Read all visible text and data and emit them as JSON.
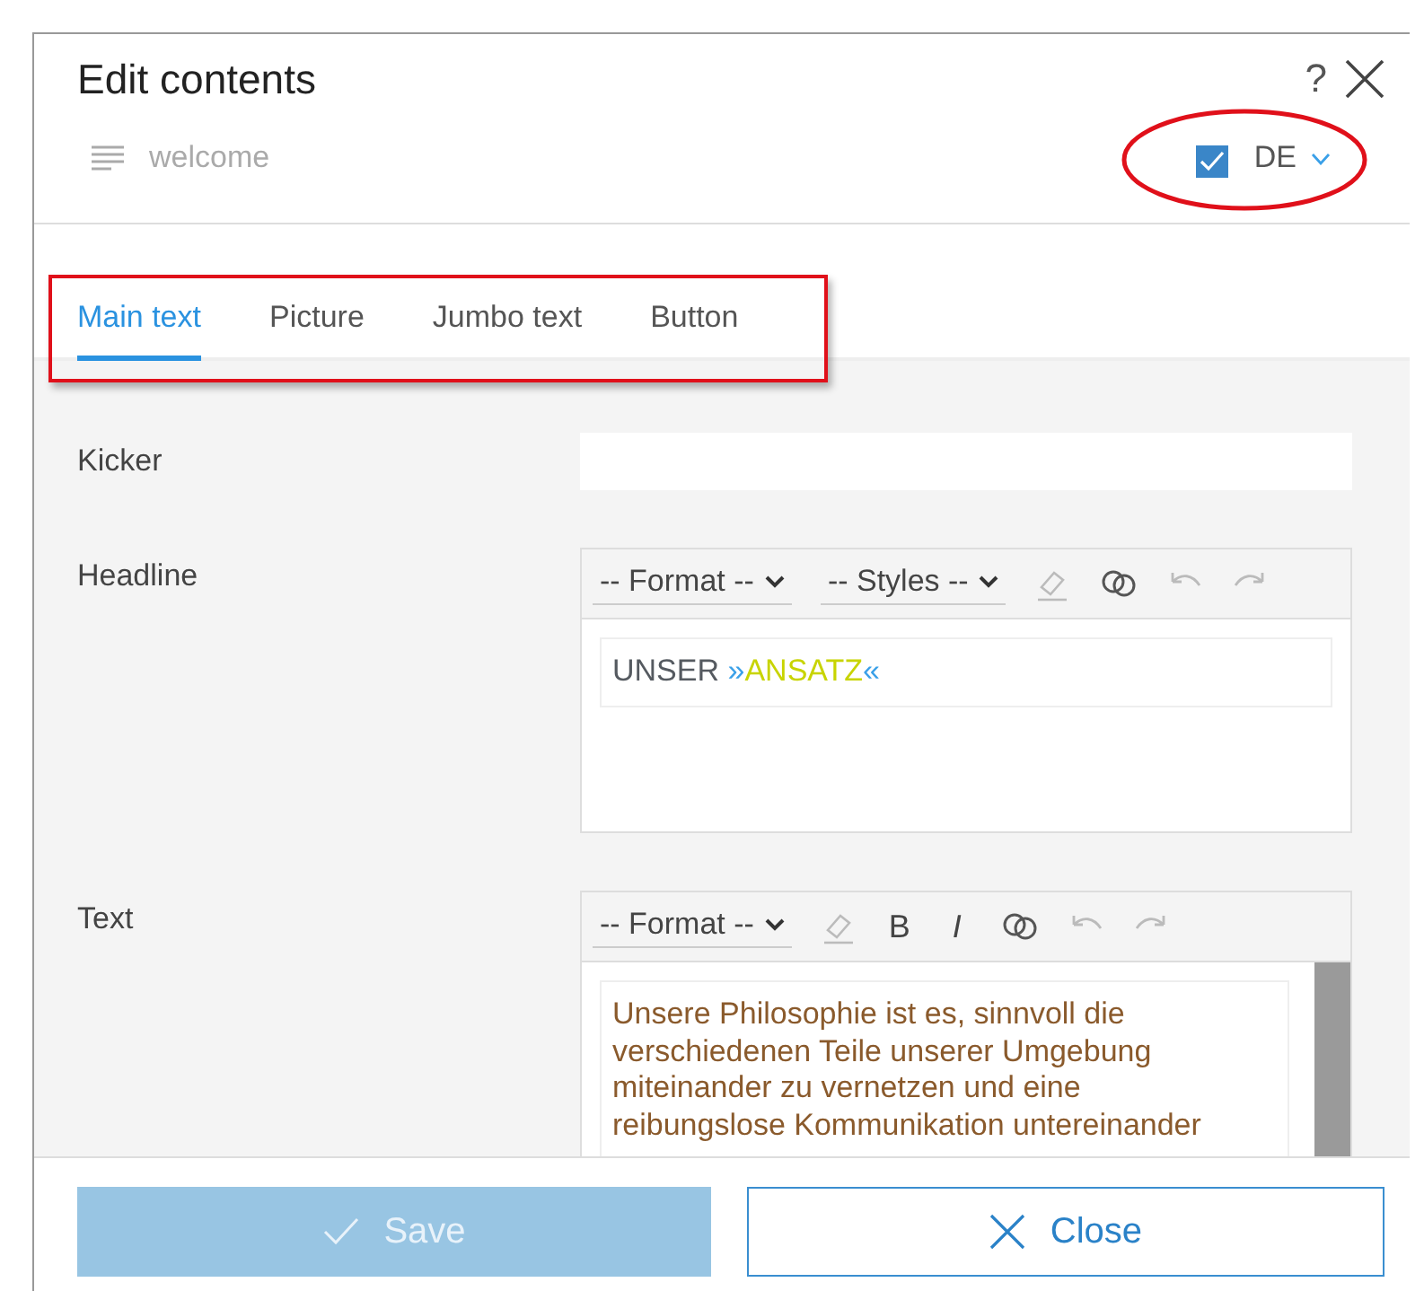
{
  "dialog": {
    "title": "Edit contents",
    "help": "?",
    "subtitle": "welcome",
    "language_enabled": {
      "checked": true
    },
    "language": "DE"
  },
  "tabs": [
    {
      "label": "Main text",
      "selected": true
    },
    {
      "label": "Picture",
      "selected": false
    },
    {
      "label": "Jumbo text",
      "selected": false
    },
    {
      "label": "Button",
      "selected": false
    }
  ],
  "fields": [
    {
      "kind": "input",
      "label": "Kicker"
    },
    {
      "kind": "editor",
      "label": "Headline",
      "toolbar": [
        {
          "kind": "select",
          "label": "-- Format --"
        },
        {
          "kind": "select",
          "label": "-- Styles --"
        },
        {
          "kind": "eraser",
          "disabled": true
        },
        {
          "kind": "link",
          "disabled": false
        },
        {
          "kind": "undo",
          "disabled": true
        },
        {
          "kind": "redo",
          "disabled": true
        }
      ],
      "content": [
        {
          "text": "UNSER ",
          "color": "#555a60"
        },
        {
          "text": "»",
          "color": "#3aa0e8"
        },
        {
          "text": "ANSATZ",
          "color": "#c8d400"
        },
        {
          "text": "«",
          "color": "#3aa0e8"
        }
      ]
    },
    {
      "kind": "editor",
      "label": "Text",
      "toolbar": [
        {
          "kind": "select",
          "label": "-- Format --"
        },
        {
          "kind": "eraser",
          "disabled": true
        },
        {
          "kind": "text",
          "label": "B",
          "disabled": false
        },
        {
          "kind": "italic",
          "label": "I",
          "disabled": false
        },
        {
          "kind": "link",
          "disabled": false
        },
        {
          "kind": "undo",
          "disabled": true
        },
        {
          "kind": "redo",
          "disabled": true
        }
      ],
      "content": [
        {
          "text": "Unsere Philosophie ist es, sinnvoll die verschiedenen Teile unserer Umgebung miteinander zu vernetzen und eine reibungslose Kommunikation untereinander",
          "color": "#8a5a2c"
        }
      ]
    }
  ],
  "buttons": [
    {
      "kind": "save",
      "label": "Save",
      "disabled": true
    },
    {
      "kind": "close",
      "label": "Close",
      "disabled": false
    }
  ]
}
